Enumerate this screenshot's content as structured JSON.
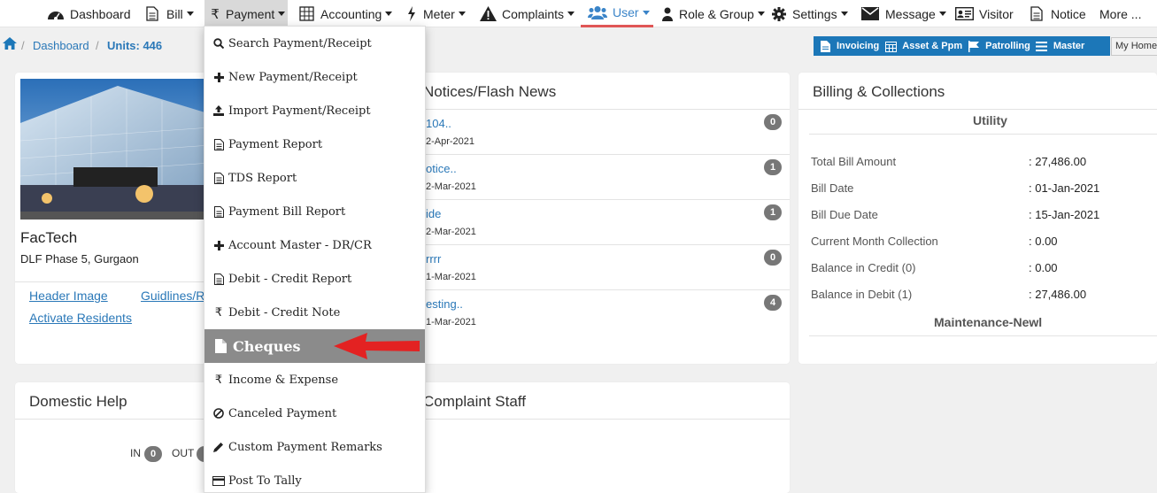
{
  "nav": {
    "dashboard": "Dashboard",
    "bill": "Bill",
    "payment": "Payment",
    "accounting": "Accounting",
    "meter": "Meter",
    "complaints": "Complaints",
    "user": "User",
    "role_group": "Role & Group",
    "settings": "Settings",
    "message": "Message",
    "visitor": "Visitor",
    "notice": "Notice",
    "more": "More ..."
  },
  "breadcrumb": {
    "home": "⌂",
    "dashboard": "Dashboard",
    "units": "Units: 446"
  },
  "quicklinks": {
    "invoicing": "Invoicing",
    "asset_ppm": "Asset & Ppm",
    "patrolling": "Patrolling",
    "master": "Master",
    "my_home": "My Home"
  },
  "society": {
    "name": "FacTech",
    "address": "DLF Phase 5, Gurgaon",
    "link_header_image": "Header Image",
    "link_guidelines": "Guidlines/R",
    "link_activate": "Activate Residents"
  },
  "notices": {
    "title": "Notices/Flash News",
    "items": [
      {
        "title": "104..",
        "date": "2-Apr-2021",
        "count": "0"
      },
      {
        "title": "otice..",
        "date": "2-Mar-2021",
        "count": "1"
      },
      {
        "title": "ide",
        "date": "2-Mar-2021",
        "count": "1"
      },
      {
        "title": "rrrr",
        "date": "1-Mar-2021",
        "count": "0"
      },
      {
        "title": "esting..",
        "date": "1-Mar-2021",
        "count": "4"
      }
    ]
  },
  "billing": {
    "title": "Billing & Collections",
    "utility_heading": "Utility",
    "rows": [
      {
        "label": "Total Bill Amount",
        "value": ": 27,486.00"
      },
      {
        "label": "Bill Date",
        "value": ": 01-Jan-2021"
      },
      {
        "label": "Bill Due Date",
        "value": ": 15-Jan-2021"
      },
      {
        "label": "Current Month Collection",
        "value": ": 0.00"
      },
      {
        "label": "Balance in Credit (0)",
        "value": ": 0.00"
      },
      {
        "label": "Balance in Debit (1)",
        "value": ": 27,486.00"
      }
    ],
    "maintenance_heading": "Maintenance-Newl"
  },
  "domestic": {
    "title": "Domestic Help",
    "in_label": "IN",
    "in_count": "0",
    "out_label": "OUT"
  },
  "complaint_staff": {
    "title": "Complaint Staff"
  },
  "payment_menu": {
    "items": [
      {
        "icon": "search-icon",
        "label": "Search Payment/Receipt"
      },
      {
        "icon": "plus-icon",
        "label": "New Payment/Receipt"
      },
      {
        "icon": "upload-icon",
        "label": "Import Payment/Receipt"
      },
      {
        "icon": "document-icon",
        "label": "Payment Report"
      },
      {
        "icon": "document-icon",
        "label": "TDS Report"
      },
      {
        "icon": "document-icon",
        "label": "Payment Bill Report"
      },
      {
        "icon": "plus-icon",
        "label": "Account Master - DR/CR"
      },
      {
        "icon": "document-icon",
        "label": "Debit - Credit Report"
      },
      {
        "icon": "rupee-icon",
        "label": "Debit - Credit Note"
      },
      {
        "icon": "file-icon",
        "label": "Cheques"
      },
      {
        "icon": "rupee-icon",
        "label": "Income & Expense"
      },
      {
        "icon": "ban-icon",
        "label": "Canceled Payment"
      },
      {
        "icon": "pencil-icon",
        "label": "Custom Payment Remarks"
      },
      {
        "icon": "credit-card-icon",
        "label": "Post To Tally"
      }
    ],
    "highlighted": "Cheques"
  },
  "colors": {
    "brand_blue": "#1c77b8",
    "link_blue": "#2a78b8",
    "highlight_grey": "#8b8b8b",
    "arrow_red": "#e32222",
    "badge_grey": "#777777"
  }
}
